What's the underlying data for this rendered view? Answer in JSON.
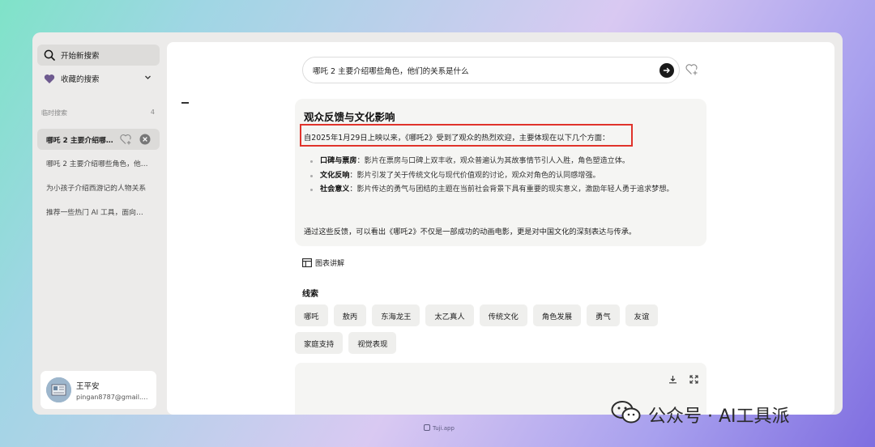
{
  "sidebar": {
    "new_search": "开始新搜索",
    "favorites": "收藏的搜索",
    "history_label": "临时搜索",
    "history_count": "4",
    "history": [
      "哪吒 2 主要介绍哪些角色，他们的关系是什么",
      "哪吒 2 主要介绍哪些角色，他们的关系是什么",
      "为小孩子介绍西游记的人物关系",
      "推荐一些热门 AI 工具，面向新手"
    ],
    "user": {
      "name": "王平安",
      "email": "pingan8787@gmail.com"
    }
  },
  "search": {
    "query": "哪吒 2 主要介绍哪些角色，他们的关系是什么"
  },
  "answer": {
    "title": "观众反馈与文化影响",
    "intro": "自2025年1月29日上映以来，《哪吒2》受到了观众的热烈欢迎，主要体现在以下几个方面：",
    "points": [
      {
        "term": "口碑与票房",
        "text": "：影片在票房与口碑上双丰收，观众普遍认为其故事情节引人入胜，角色塑造立体。"
      },
      {
        "term": "文化反响",
        "text": "：影片引发了关于传统文化与现代价值观的讨论，观众对角色的认同感增强。"
      },
      {
        "term": "社会意义",
        "text": "：影片传达的勇气与团结的主题在当前社会背景下具有重要的现实意义，激励年轻人勇于追求梦想。"
      }
    ],
    "outro": "通过这些反馈，可以看出《哪吒2》不仅是一部成功的动画电影，更是对中国文化的深刻表达与传承。"
  },
  "chart_link": "图表讲解",
  "clues": {
    "title": "线索",
    "tags": [
      "哪吒",
      "敖丙",
      "东海龙王",
      "太乙真人",
      "传统文化",
      "角色发展",
      "勇气",
      "友谊",
      "家庭支持",
      "视觉表现"
    ]
  },
  "watermark": "公众号 · AI工具派",
  "footer": "Tuji.app",
  "colors": {
    "highlight_border": "#e0332b",
    "accent_dark": "#1a1a1a"
  }
}
